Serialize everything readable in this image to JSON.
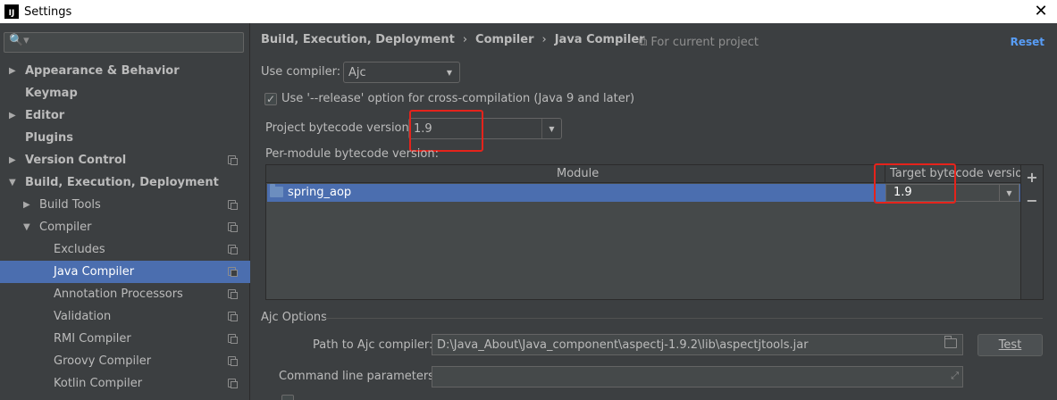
{
  "window": {
    "title": "Settings",
    "app_badge": "IJ",
    "close_glyph": "✕"
  },
  "sidebar": {
    "search_glyph": "🔍▾",
    "items": [
      {
        "label": "Appearance & Behavior",
        "arrow": "▶",
        "bold": true
      },
      {
        "label": "Keymap",
        "arrow": "",
        "bold": true
      },
      {
        "label": "Editor",
        "arrow": "▶",
        "bold": true
      },
      {
        "label": "Plugins",
        "arrow": "",
        "bold": true
      },
      {
        "label": "Version Control",
        "arrow": "▶",
        "bold": true
      },
      {
        "label": "Build, Execution, Deployment",
        "arrow": "▼",
        "bold": true
      },
      {
        "label": "Build Tools",
        "arrow": "▶",
        "bold": false
      },
      {
        "label": "Compiler",
        "arrow": "▼",
        "bold": false
      },
      {
        "label": "Excludes",
        "arrow": "",
        "bold": false
      },
      {
        "label": "Java Compiler",
        "arrow": "",
        "bold": false
      },
      {
        "label": "Annotation Processors",
        "arrow": "",
        "bold": false
      },
      {
        "label": "Validation",
        "arrow": "",
        "bold": false
      },
      {
        "label": "RMI Compiler",
        "arrow": "",
        "bold": false
      },
      {
        "label": "Groovy Compiler",
        "arrow": "",
        "bold": false
      },
      {
        "label": "Kotlin Compiler",
        "arrow": "",
        "bold": false
      }
    ]
  },
  "main": {
    "breadcrumb": [
      "Build, Execution, Deployment",
      "Compiler",
      "Java Compiler"
    ],
    "breadcrumb_sep": "›",
    "scope_label": "⧉ For current project",
    "reset_label": "Reset",
    "use_compiler_label": "Use compiler:",
    "use_compiler_value": "Ajc",
    "release_option_label": "Use '--release' option for cross-compilation (Java 9 and later)",
    "release_option_checked": true,
    "check_glyph": "✓",
    "dropdown_glyph": "▼",
    "project_bytecode_label": "Project bytecode version:",
    "project_bytecode_value": "1.9",
    "per_module_label": "Per-module bytecode version:",
    "table": {
      "col_module": "Module",
      "col_target": "Target bytecode version",
      "rows": [
        {
          "module": "spring_aop",
          "target": "1.9"
        }
      ],
      "add_glyph": "+",
      "remove_glyph": "−"
    },
    "ajc_section_label": "Ajc Options",
    "path_label": "Path to Ajc compiler:",
    "path_value": "D:\\Java_About\\Java_component\\aspectj-1.9.2\\lib\\aspectjtools.jar",
    "test_button_label": "Test",
    "cmdline_label": "Command line parameters:",
    "cmdline_value": "",
    "expand_glyph": "⤢"
  },
  "colors": {
    "accent": "#4b6eaf",
    "link": "#589df6",
    "highlight": "#e5231b"
  }
}
